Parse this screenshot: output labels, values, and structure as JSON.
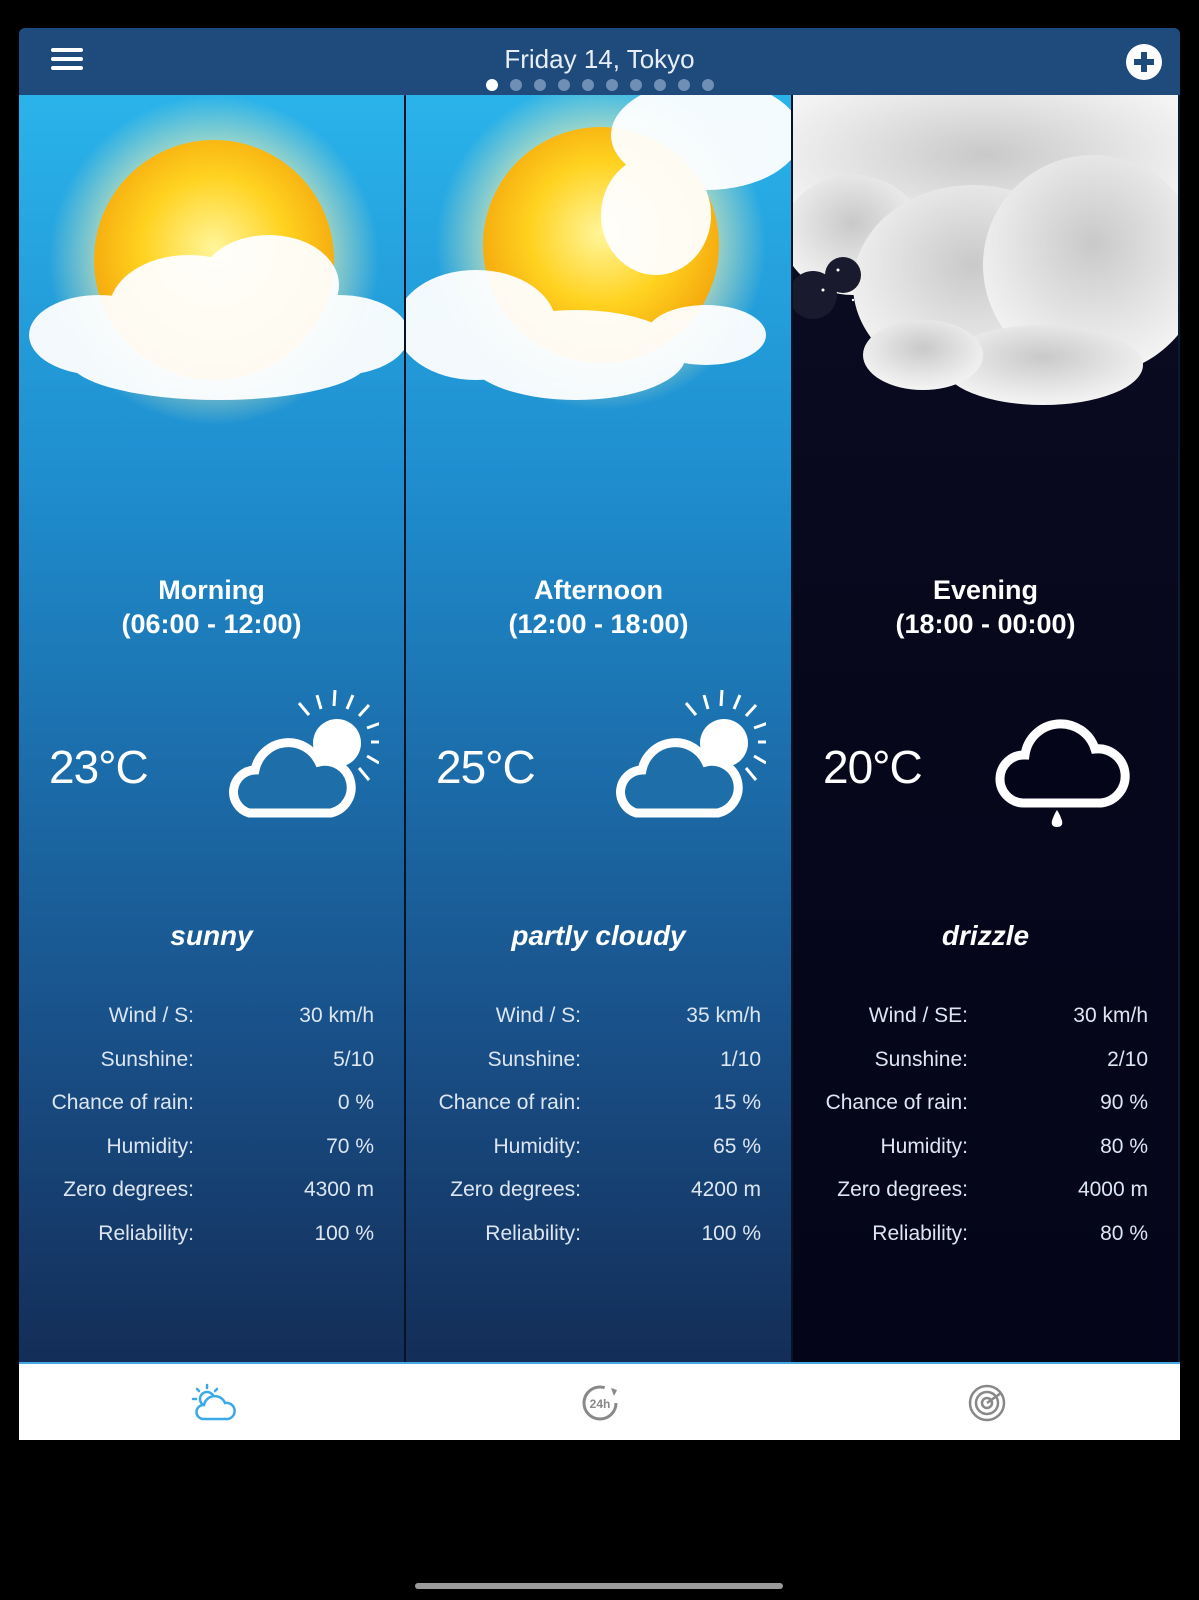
{
  "header": {
    "title": "Friday 14, Tokyo",
    "page_count": 10,
    "active_page": 1,
    "menu_icon": "hamburger-menu-icon",
    "add_icon": "plus-circle-icon"
  },
  "periods": [
    {
      "name": "Morning",
      "range": "(06:00 - 12:00)",
      "temp": "23°C",
      "condition": "sunny",
      "icon": "partly-sunny-icon",
      "details": [
        {
          "label": "Wind / S:",
          "value": "30 km/h"
        },
        {
          "label": "Sunshine:",
          "value": "5/10"
        },
        {
          "label": "Chance of rain:",
          "value": "0 %"
        },
        {
          "label": "Humidity:",
          "value": "70 %"
        },
        {
          "label": "Zero degrees:",
          "value": "4300 m"
        },
        {
          "label": "Reliability:",
          "value": "100 %"
        }
      ]
    },
    {
      "name": "Afternoon",
      "range": "(12:00 - 18:00)",
      "temp": "25°C",
      "condition": "partly cloudy",
      "icon": "partly-sunny-icon",
      "details": [
        {
          "label": "Wind / S:",
          "value": "35 km/h"
        },
        {
          "label": "Sunshine:",
          "value": "1/10"
        },
        {
          "label": "Chance of rain:",
          "value": "15 %"
        },
        {
          "label": "Humidity:",
          "value": "65 %"
        },
        {
          "label": "Zero degrees:",
          "value": "4200 m"
        },
        {
          "label": "Reliability:",
          "value": "100 %"
        }
      ]
    },
    {
      "name": "Evening",
      "range": "(18:00 - 00:00)",
      "temp": "20°C",
      "condition": "drizzle",
      "icon": "drizzle-cloud-icon",
      "details": [
        {
          "label": "Wind / SE:",
          "value": "30 km/h"
        },
        {
          "label": "Sunshine:",
          "value": "2/10"
        },
        {
          "label": "Chance of rain:",
          "value": "90 %"
        },
        {
          "label": "Humidity:",
          "value": "80 %"
        },
        {
          "label": "Zero degrees:",
          "value": "4000 m"
        },
        {
          "label": "Reliability:",
          "value": "80 %"
        }
      ]
    }
  ],
  "tabs": [
    {
      "icon": "weather-icon",
      "active": true
    },
    {
      "icon": "24h-forecast-icon",
      "active": false
    },
    {
      "icon": "radar-icon",
      "active": false
    }
  ],
  "colors": {
    "header": "#1e4a7c",
    "tab_active": "#3aa9e8",
    "tab_inactive": "#888888"
  }
}
